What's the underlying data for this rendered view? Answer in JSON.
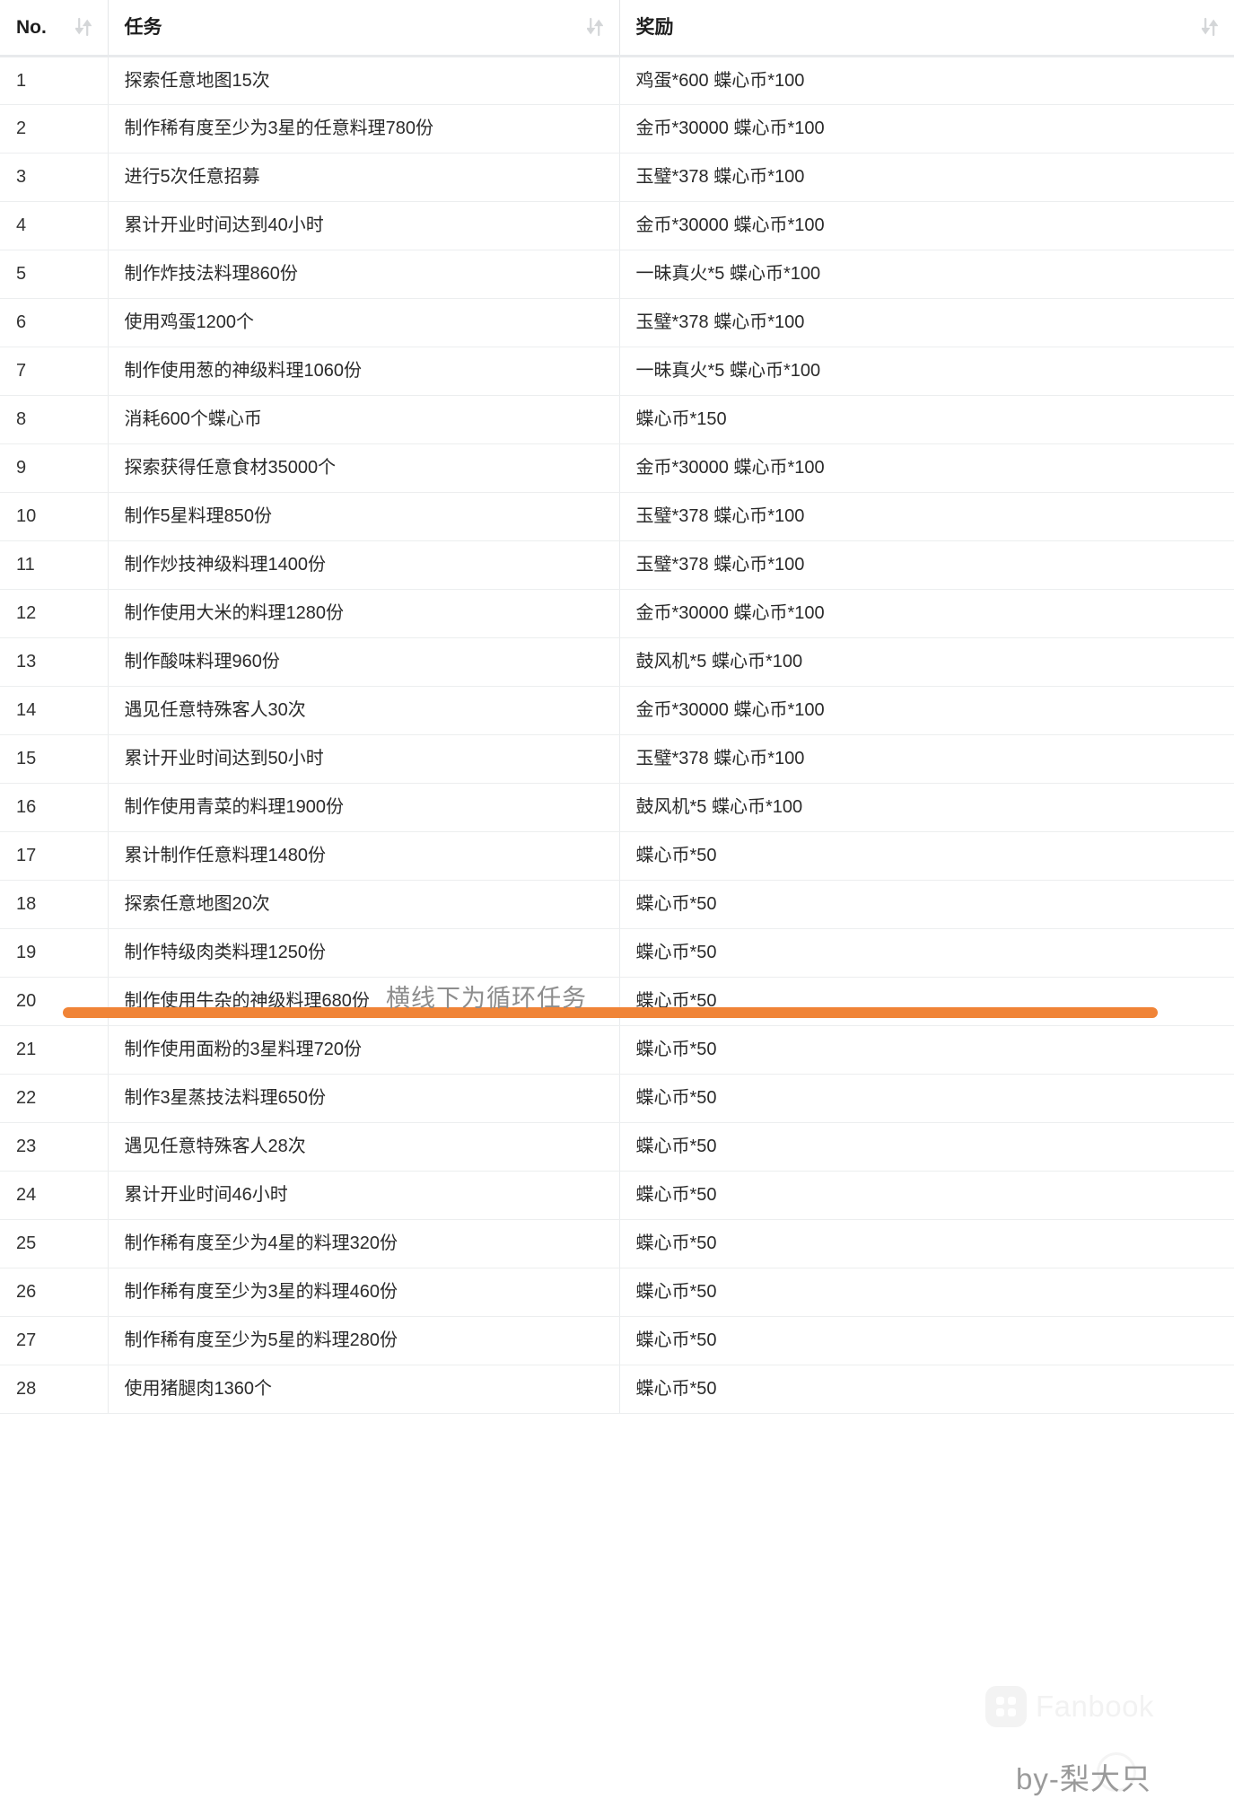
{
  "table": {
    "columns": [
      {
        "key": "no",
        "label": "No.",
        "sortable": true,
        "sort_icon": "sort-updown-icon"
      },
      {
        "key": "task",
        "label": "任务",
        "sortable": true,
        "sort_icon": "sort-updown-icon"
      },
      {
        "key": "award",
        "label": "奖励",
        "sortable": true,
        "sort_icon": "sort-updown-icon"
      }
    ],
    "rows": [
      {
        "no": "1",
        "task": "探索任意地图15次",
        "award": "鸡蛋*600 蝶心币*100"
      },
      {
        "no": "2",
        "task": "制作稀有度至少为3星的任意料理780份",
        "award": "金币*30000 蝶心币*100"
      },
      {
        "no": "3",
        "task": "进行5次任意招募",
        "award": "玉璧*378 蝶心币*100"
      },
      {
        "no": "4",
        "task": "累计开业时间达到40小时",
        "award": "金币*30000 蝶心币*100"
      },
      {
        "no": "5",
        "task": "制作炸技法料理860份",
        "award": "一昧真火*5 蝶心币*100"
      },
      {
        "no": "6",
        "task": "使用鸡蛋1200个",
        "award": "玉璧*378 蝶心币*100"
      },
      {
        "no": "7",
        "task": "制作使用葱的神级料理1060份",
        "award": "一昧真火*5 蝶心币*100"
      },
      {
        "no": "8",
        "task": "消耗600个蝶心币",
        "award": "蝶心币*150"
      },
      {
        "no": "9",
        "task": "探索获得任意食材35000个",
        "award": "金币*30000 蝶心币*100"
      },
      {
        "no": "10",
        "task": "制作5星料理850份",
        "award": "玉璧*378 蝶心币*100"
      },
      {
        "no": "11",
        "task": "制作炒技神级料理1400份",
        "award": "玉璧*378 蝶心币*100"
      },
      {
        "no": "12",
        "task": "制作使用大米的料理1280份",
        "award": "金币*30000 蝶心币*100"
      },
      {
        "no": "13",
        "task": "制作酸味料理960份",
        "award": "鼓风机*5 蝶心币*100"
      },
      {
        "no": "14",
        "task": "遇见任意特殊客人30次",
        "award": "金币*30000 蝶心币*100"
      },
      {
        "no": "15",
        "task": "累计开业时间达到50小时",
        "award": "玉璧*378 蝶心币*100"
      },
      {
        "no": "16",
        "task": "制作使用青菜的料理1900份",
        "award": "鼓风机*5 蝶心币*100"
      },
      {
        "no": "17",
        "task": "累计制作任意料理1480份",
        "award": "蝶心币*50"
      },
      {
        "no": "18",
        "task": "探索任意地图20次",
        "award": "蝶心币*50"
      },
      {
        "no": "19",
        "task": "制作特级肉类料理1250份",
        "award": "蝶心币*50"
      },
      {
        "no": "20",
        "task": "制作使用牛杂的神级料理680份",
        "award": "蝶心币*50"
      },
      {
        "no": "21",
        "task": "制作使用面粉的3星料理720份",
        "award": "蝶心币*50"
      },
      {
        "no": "22",
        "task": "制作3星蒸技法料理650份",
        "award": "蝶心币*50"
      },
      {
        "no": "23",
        "task": "遇见任意特殊客人28次",
        "award": "蝶心币*50"
      },
      {
        "no": "24",
        "task": "累计开业时间46小时",
        "award": "蝶心币*50"
      },
      {
        "no": "25",
        "task": "制作稀有度至少为4星的料理320份",
        "award": "蝶心币*50"
      },
      {
        "no": "26",
        "task": "制作稀有度至少为3星的料理460份",
        "award": "蝶心币*50"
      },
      {
        "no": "27",
        "task": "制作稀有度至少为5星的料理280份",
        "award": "蝶心币*50"
      },
      {
        "no": "28",
        "task": "使用猪腿肉1360个",
        "award": "蝶心币*50"
      }
    ]
  },
  "annotation": {
    "text": "横线下为循环任务",
    "divider_color": "#f08437",
    "divider_after_row": 16
  },
  "watermarks": {
    "brand": "Fanbook",
    "author": "by-梨大只"
  }
}
